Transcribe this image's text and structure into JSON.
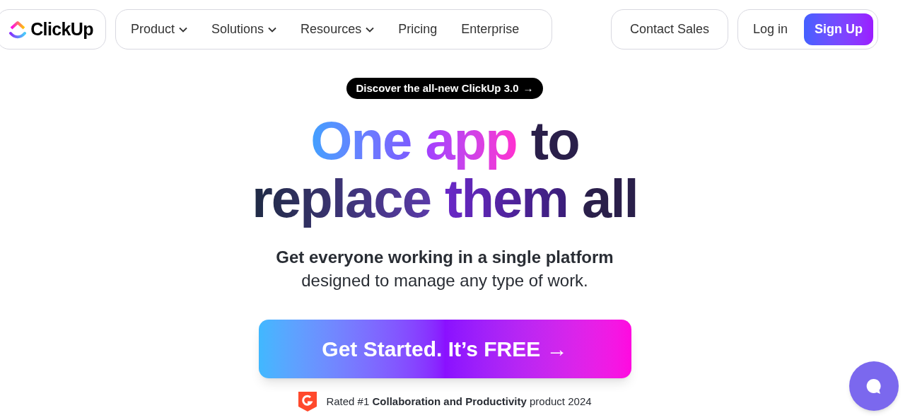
{
  "logo": {
    "text": "ClickUp"
  },
  "nav": [
    {
      "label": "Product",
      "dropdown": true
    },
    {
      "label": "Solutions",
      "dropdown": true
    },
    {
      "label": "Resources",
      "dropdown": true
    },
    {
      "label": "Pricing",
      "dropdown": false
    },
    {
      "label": "Enterprise",
      "dropdown": false
    }
  ],
  "contact_button": "Contact Sales",
  "login_link": "Log in",
  "signup_button": "Sign Up",
  "announcement": {
    "text": "Discover the all-new ClickUp 3.0",
    "arrow": "→"
  },
  "headline": [
    [
      {
        "text": "One",
        "kind": "blue"
      },
      {
        "text": "app",
        "kind": "pink"
      },
      {
        "text": "to",
        "kind": "dark"
      }
    ],
    [
      {
        "text": "replace",
        "kind": "fade"
      },
      {
        "text": "them",
        "kind": "purple"
      },
      {
        "text": "all",
        "kind": "dark"
      }
    ]
  ],
  "subtitle": {
    "bold": "Get everyone working in a single platform",
    "normal": "designed to manage any type of work."
  },
  "cta_button": "Get Started. It’s FREE →",
  "rating": "Rated #1 **Collaboration and Productivity** product 2024"
}
